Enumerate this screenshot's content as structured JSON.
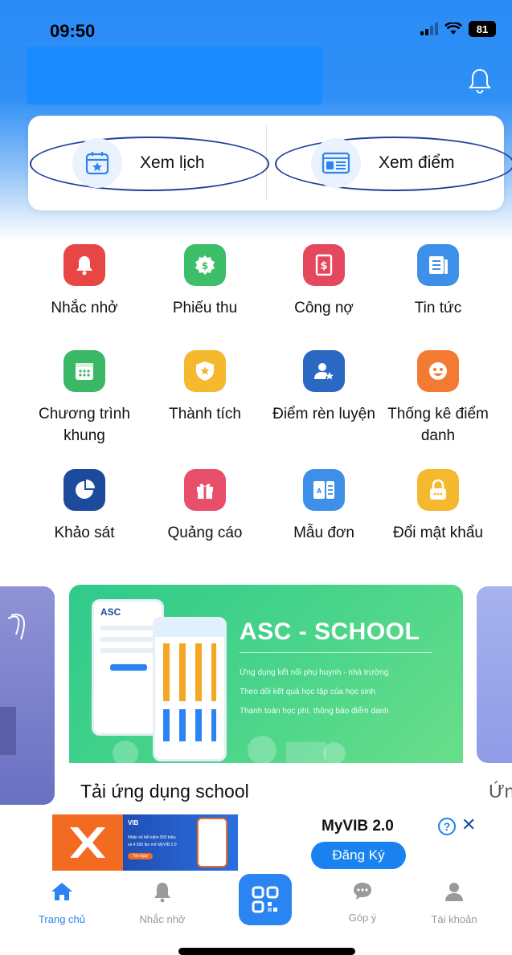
{
  "status_bar": {
    "time": "09:50",
    "battery": "81"
  },
  "quick_actions": [
    {
      "label": "Xem lịch",
      "icon": "calendar-star-icon"
    },
    {
      "label": "Xem điểm",
      "icon": "id-card-icon"
    }
  ],
  "features": [
    {
      "label": "Nhắc nhở",
      "icon": "bell-icon",
      "color": "#e84545"
    },
    {
      "label": "Phiếu thu",
      "icon": "money-badge-icon",
      "color": "#3dbf6a"
    },
    {
      "label": "Công nợ",
      "icon": "invoice-dollar-icon",
      "color": "#e5485d"
    },
    {
      "label": "Tin tức",
      "icon": "newspaper-icon",
      "color": "#3d8fe8"
    },
    {
      "label": "Chương trình khung",
      "icon": "calendar-grid-icon",
      "color": "#3ab865"
    },
    {
      "label": "Thành tích",
      "icon": "shield-star-icon",
      "color": "#f5b82e"
    },
    {
      "label": "Điểm rèn luyện",
      "icon": "user-star-icon",
      "color": "#2b68c4"
    },
    {
      "label": "Thống kê điểm danh",
      "icon": "smile-chart-icon",
      "color": "#f27a33"
    },
    {
      "label": "Khảo sát",
      "icon": "pie-chart-icon",
      "color": "#1c4a9c"
    },
    {
      "label": "Quảng cáo",
      "icon": "gift-icon",
      "color": "#e8506a"
    },
    {
      "label": "Mẫu đơn",
      "icon": "form-doc-icon",
      "color": "#3d8fe8"
    },
    {
      "label": "Đổi mật khẩu",
      "icon": "lock-icon",
      "color": "#f5b82e"
    }
  ],
  "banner": {
    "title": "ASC - SCHOOL",
    "line1": "Ứng dụng kết nối phụ huynh - nhà trường",
    "line2": "Theo dõi kết quả học tập của học sinh",
    "line3": "Thanh toán học phí, thông báo điểm danh",
    "caption": "Tải ứng dụng school",
    "next_caption": "Ứn",
    "phone_logo": "ASC"
  },
  "ad": {
    "title": "MyVIB 2.0",
    "cta": "Đăng Ký",
    "brand": "VIB",
    "small_text_1": "Nhận số tiết kiệm 500 triệu",
    "small_text_2": "và 4.500 lần mở MyVIB 2.0",
    "small_cta": "Tải ngay",
    "info": "?",
    "close": "✕"
  },
  "tabs": [
    {
      "label": "Trang chủ",
      "icon": "home-icon",
      "active": true
    },
    {
      "label": "Nhắc nhở",
      "icon": "bell-icon"
    },
    {
      "label": "",
      "icon": "qr-code-icon"
    },
    {
      "label": "Góp ý",
      "icon": "chat-bubble-icon"
    },
    {
      "label": "Tài khoản",
      "icon": "user-icon"
    }
  ],
  "colors": {
    "primary": "#2a84f2",
    "header": "#2e8ff6",
    "banner_green": "#48d48a"
  }
}
